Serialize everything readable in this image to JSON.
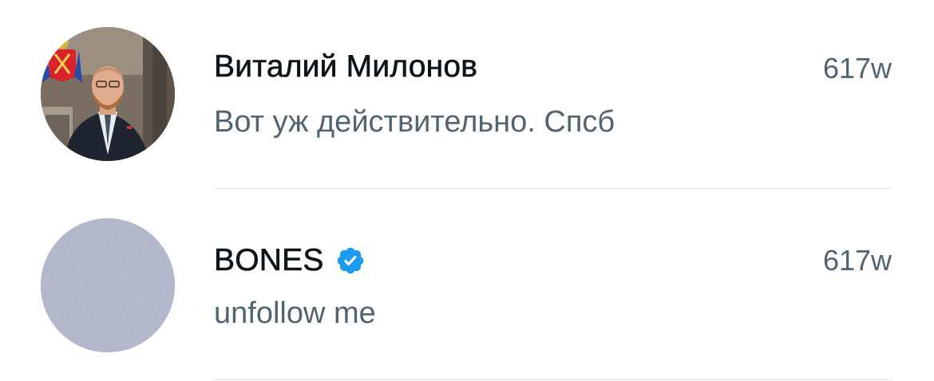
{
  "conversations": [
    {
      "name": "Виталий Милонов",
      "verified": false,
      "time": "617w",
      "message": "Вот уж действительно. Спсб"
    },
    {
      "name": "BONES",
      "verified": true,
      "time": "617w",
      "message": "unfollow me"
    }
  ],
  "colors": {
    "name_text": "#0f1419",
    "secondary_text": "#536471",
    "verified_blue": "#1d9bf0",
    "divider": "#e1e5e8"
  }
}
